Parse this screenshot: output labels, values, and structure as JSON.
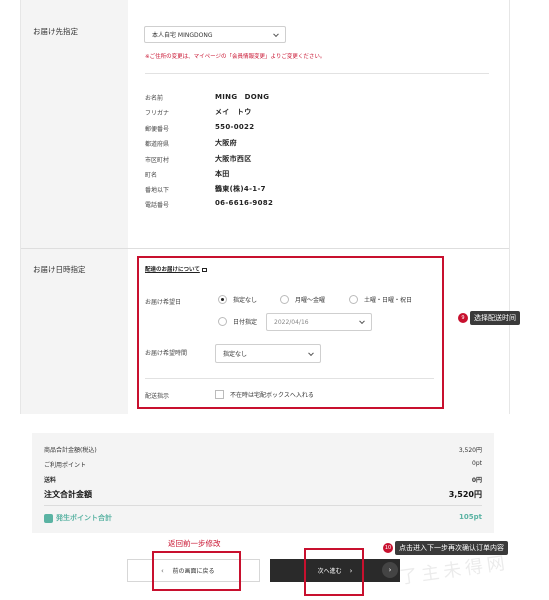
{
  "shipping": {
    "label": "お届け先指定",
    "address_select": "本人自宅 MINGDONG",
    "note": "※ご住所の変更は、マイページの「会員情報変更」よりご変更ください。",
    "fields": [
      {
        "key": "お名前",
        "value": "MING　DONG"
      },
      {
        "key": "フリガナ",
        "value": "メイ　トウ"
      },
      {
        "key": "郵便番号",
        "value": "550-0022"
      },
      {
        "key": "都道府県",
        "value": "大阪府"
      },
      {
        "key": "市区町村",
        "value": "大阪市西区"
      },
      {
        "key": "町名",
        "value": "本田"
      },
      {
        "key": "番地以下",
        "value": "鶴東(株)4-1-7"
      },
      {
        "key": "電話番号",
        "value": "06-6616-9082"
      }
    ]
  },
  "delivery": {
    "label": "お届け日時指定",
    "link": "配達のお届けについて",
    "date_label": "お届け希望日",
    "options": {
      "none": "指定なし",
      "weekday": "月曜〜金曜",
      "weekend": "土曜・日曜・祝日",
      "date": "日付指定"
    },
    "date_value": "2022/04/16",
    "time_label": "お届け希望時間",
    "time_value": "指定なし",
    "instruction_label": "配送指示",
    "absent_option": "不在時は宅配ボックスへ入れる"
  },
  "callouts": {
    "delivery_num": "9",
    "delivery_text": "选择配送时间",
    "next_num": "10",
    "next_text": "点击进入下一步再次确认订单内容",
    "back_text": "返回前一步修改"
  },
  "summary": {
    "rows": [
      {
        "label": "商品合計金額(税込)",
        "value": "3,520円"
      },
      {
        "label": "ご利用ポイント",
        "value": "0pt"
      },
      {
        "label": "送料",
        "value": "0円"
      }
    ],
    "total_label": "注文合計金額",
    "total_value": "3,520円",
    "points_label": "発生ポイント合計",
    "points_value": "105pt"
  },
  "buttons": {
    "back": "前の画面に戻る",
    "next": "次へ進む"
  },
  "watermark": "了主未得网",
  "colors": {
    "accent_red": "#c8102e",
    "points_teal": "#5ab3a3",
    "button_dark": "#2a2a2a"
  }
}
